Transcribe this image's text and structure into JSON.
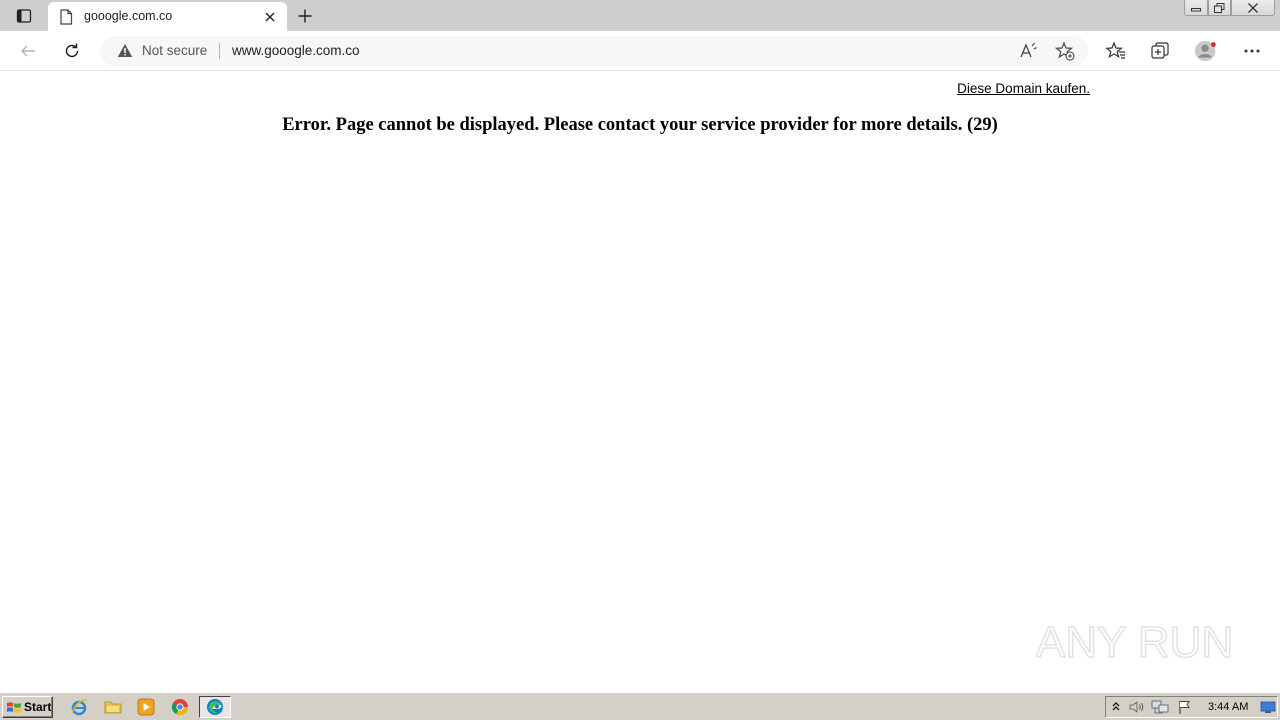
{
  "browser": {
    "tab": {
      "title": "gooogle.com.co"
    },
    "address": {
      "security_label": "Not secure",
      "url": "www.gooogle.com.co"
    }
  },
  "page": {
    "buy_link": "Diese Domain kaufen.",
    "error_message": "Error. Page cannot be displayed. Please contact your service provider for more details. (29)"
  },
  "watermark": {
    "text": "ANY RUN"
  },
  "taskbar": {
    "start_label": "Start",
    "clock": "3:44 AM"
  },
  "colors": {
    "tabstrip": "#cfcfcf",
    "address_bg": "#f7f7f7",
    "taskbar": "#d4d0c8",
    "edge_blue": "#0c7bd6",
    "edge_green": "#3fbf5a"
  }
}
